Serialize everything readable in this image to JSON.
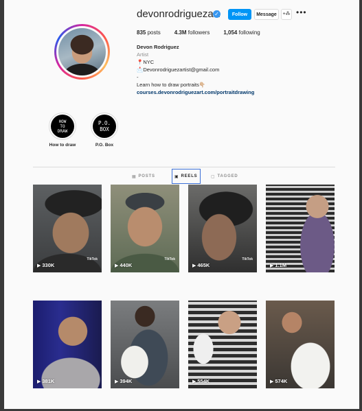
{
  "profile": {
    "username": "devonrodriguezart",
    "verified_icon": "verified-badge-icon",
    "follow_label": "Follow",
    "message_label": "Message",
    "suggest_icon": "add-person-icon",
    "more_icon": "more-horizontal-icon",
    "more_glyph": "•••",
    "stats": {
      "posts_count": "835",
      "posts_label": "posts",
      "followers_count": "4.3M",
      "followers_label": "followers",
      "following_count": "1,054",
      "following_label": "following"
    },
    "bio": {
      "name": "Devon Rodriguez",
      "category": "Artist",
      "location_icon": "📍",
      "location": "NYC",
      "email_icon": "📩",
      "email": "Devonrodriguezartist@gmail.com",
      "separator": "-",
      "tagline": "Learn how to draw portraits👇🏼",
      "link": "courses.devonrodriguezart.com/portraitdrawing"
    }
  },
  "highlights": [
    {
      "cover_text": "HOW\nTO\nDRAW",
      "label": "How to draw"
    },
    {
      "cover_text": "P.O.\nBOX",
      "label": "P.O. Box"
    }
  ],
  "tabs": [
    {
      "icon": "▦",
      "label": "POSTS",
      "active": false
    },
    {
      "icon": "▣",
      "label": "REELS",
      "active": true
    },
    {
      "icon": "▢",
      "label": "TAGGED",
      "active": false
    }
  ],
  "reels": [
    {
      "views": "330K",
      "tiktok": "TikTok"
    },
    {
      "views": "440K",
      "tiktok": "TikTok"
    },
    {
      "views": "465K",
      "tiktok": "TikTok"
    },
    {
      "views": "1.1M",
      "tiktok": ""
    },
    {
      "views": "381K",
      "tiktok": ""
    },
    {
      "views": "394K",
      "tiktok": ""
    },
    {
      "views": "554K",
      "tiktok": ""
    },
    {
      "views": "574K",
      "tiktok": ""
    }
  ],
  "colors": {
    "accent": "#0095f6",
    "link": "#00376b",
    "active_tab_outline": "#3b6fd6"
  }
}
